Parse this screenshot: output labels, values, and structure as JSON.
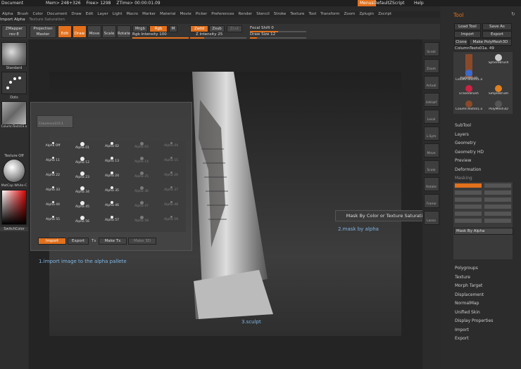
{
  "titlebar": {
    "document": "Document",
    "mem": "Mem> 248+326",
    "free": "Free> 1298",
    "ztime": "ZTime> 00:00:01.09",
    "menus": "Menus",
    "script": "DefaultZScript",
    "help": "Help"
  },
  "menubar": [
    "Alpha",
    "Brush",
    "Color",
    "Document",
    "Draw",
    "Edit",
    "Layer",
    "Light",
    "Macro",
    "Marker",
    "Material",
    "Movie",
    "Picker",
    "Preferences",
    "Render",
    "Stencil",
    "Stroke",
    "Texture",
    "Tool",
    "Transform",
    "Zoom",
    "Zplugin",
    "Zscript"
  ],
  "breadcrumb": {
    "a": "Import Alpha",
    "b": "Texture Saturation"
  },
  "toolbar": {
    "zmapper": "ZMapper",
    "rev": "rev-E",
    "projection": "Projection",
    "master": "Master",
    "edit": "Edit",
    "draw": "Draw",
    "move": "Move",
    "scale": "Scale",
    "rotate": "Rotate",
    "mrgb": "Mrgb",
    "rgb": "Rgb",
    "m": "M",
    "rgb_intensity": "Rgb Intensity 100",
    "zadd": "Zadd",
    "zsub": "Zsub",
    "zcut": "Zcut",
    "z_intensity": "Z Intensity 25",
    "focal_shift": "Focal Shift 0",
    "draw_size": "Draw Size 12",
    "rgb_intensity_level": 1.0,
    "z_intensity_level": 0.25,
    "focal_level": 0.5,
    "draw_size_level": 0.12
  },
  "leftshelf": {
    "standard": "Standard",
    "dots": "Dots",
    "alpha_thumb": "ColumnTexts03.o",
    "texture": "Texture Off",
    "matcap": "MatCap White-C",
    "switchcolor": "SwitchColor"
  },
  "alpha_palette": {
    "header": "Columnsx103.1",
    "cells": [
      "Alpha Off",
      "Alpha 01",
      "Alpha 02",
      "Alpha 03",
      "Alpha 04",
      "Alpha 11",
      "Alpha 12",
      "Alpha 13",
      "Alpha 14",
      "Alpha 15",
      "Alpha 22",
      "Alpha 23",
      "Alpha 24",
      "Alpha 25",
      "Alpha 26",
      "Alpha 33",
      "Alpha 34",
      "Alpha 35",
      "Alpha 36",
      "Alpha 37",
      "Alpha 44",
      "Alpha 45",
      "Alpha 46",
      "Alpha 47",
      "Alpha 48",
      "Alpha 55",
      "Alpha 56",
      "Alpha 57",
      "Alpha 58",
      "Alpha 59"
    ],
    "import": "Import",
    "export": "Export",
    "tx": "Tx",
    "make_tx": "Make Tx",
    "make_3d": "Make 3D"
  },
  "annotations": {
    "a1": "1.import image to the alpha pallete",
    "a2": "2.mask by alpha",
    "a3": "3.sculpt"
  },
  "tooltip": "Mask By Color or Texture Saturation",
  "rightdock": [
    "Scroll",
    "Zoom",
    "Actual",
    "AAHalf",
    "Local",
    "L.Sym",
    "Move",
    "Scale",
    "Rotate",
    "Frame",
    "Lasso"
  ],
  "toolpanel": {
    "title": "Tool",
    "load": "Load Tool",
    "save": "Save As",
    "import": "Import",
    "export": "Export",
    "clone": "Clone",
    "make_poly": "Make PolyMesh3D",
    "current": "ColumnTexts01a. 49",
    "brushes": [
      "ColumnTexts01.o",
      "SphereBrush",
      "AlphaBrush",
      "SimpleBrush",
      "EraserBrush",
      "PolyMesh3D",
      "ColumnTexts01.o"
    ],
    "sections": [
      "SubTool",
      "Layers",
      "Geometry",
      "Geometry HD",
      "Preview",
      "Deformation",
      "Masking"
    ],
    "mask_by_alpha": "Mask By Alpha",
    "sections2": [
      "Polygroups",
      "Texture",
      "Morph Target",
      "Displacement",
      "NormalMap",
      "Unified Skin",
      "Display Properties",
      "Import",
      "Export"
    ]
  }
}
